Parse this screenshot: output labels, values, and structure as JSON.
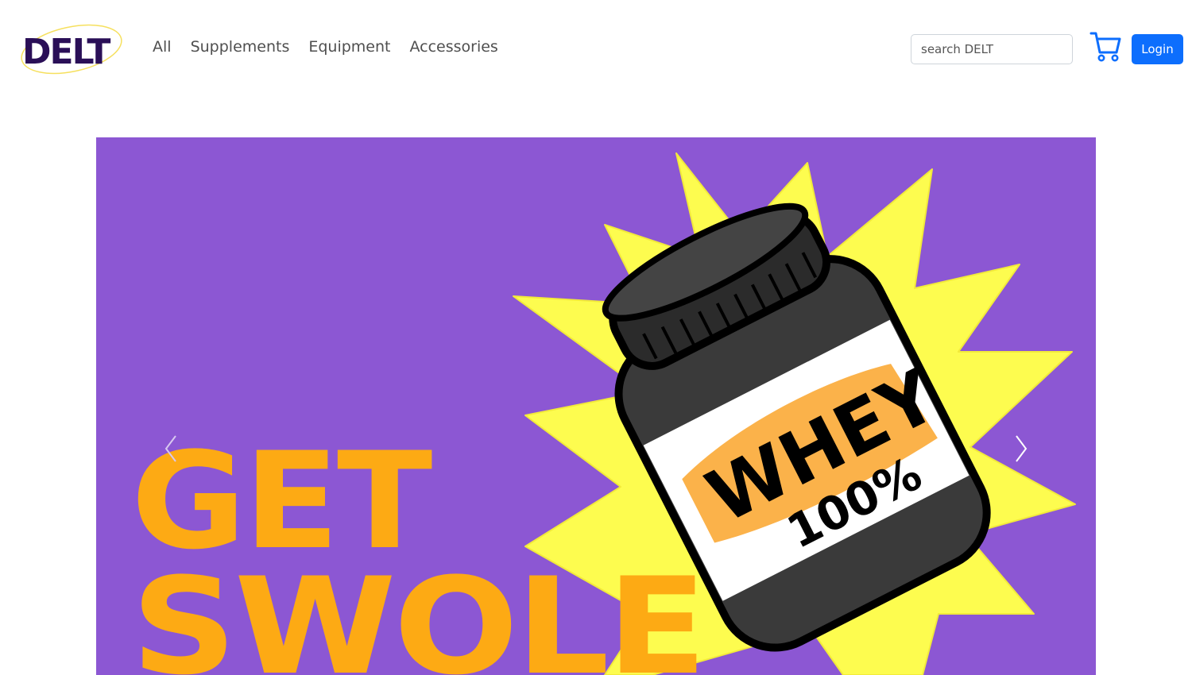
{
  "header": {
    "logo_text": "DELT",
    "nav": [
      {
        "label": "All"
      },
      {
        "label": "Supplements"
      },
      {
        "label": "Equipment"
      },
      {
        "label": "Accessories"
      }
    ],
    "search": {
      "placeholder": "search DELT",
      "value": ""
    },
    "cart_icon": "shopping-cart-icon",
    "login_label": "Login"
  },
  "hero": {
    "line1": "GET",
    "line2": "SWOLE",
    "jar_label": "WHEY",
    "jar_sublabel": "100%",
    "prev_icon": "chevron-left-icon",
    "next_icon": "chevron-right-icon"
  },
  "colors": {
    "brand": "#2a0f57",
    "accent": "#0d6efd",
    "banner_bg": "#8c57d3",
    "hero_text": "#fdaa14",
    "burst": "#fdfc4f"
  }
}
